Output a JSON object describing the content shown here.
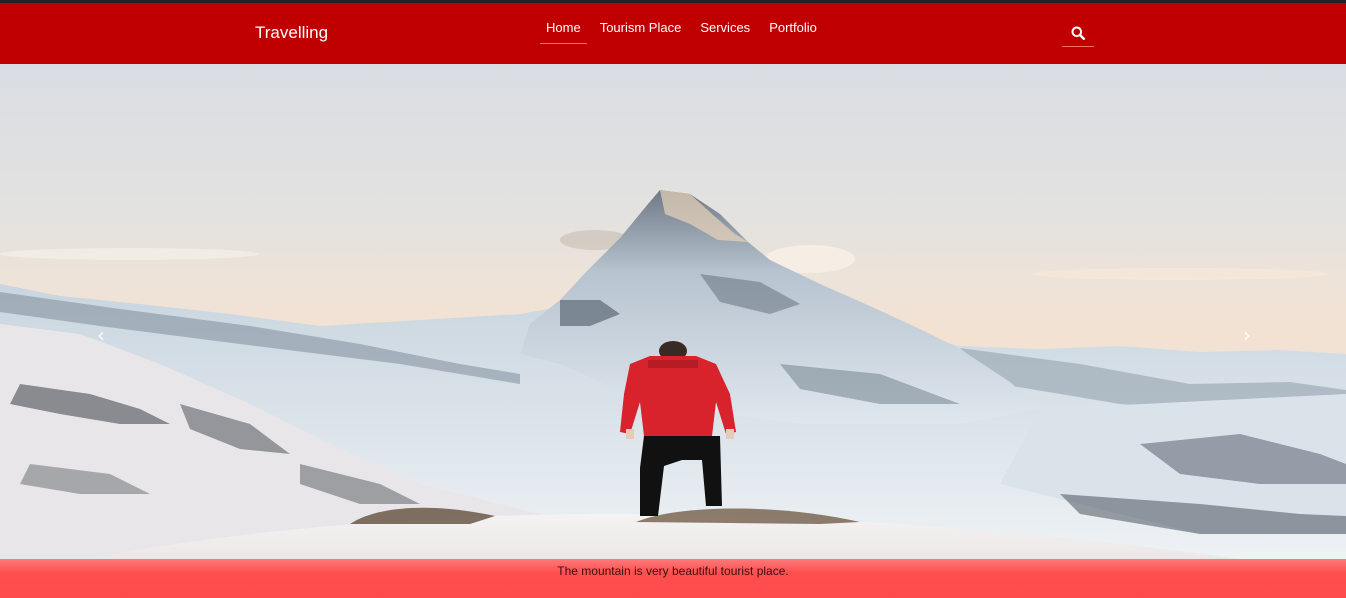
{
  "brand": {
    "title": "Travelling"
  },
  "nav": {
    "items": [
      {
        "label": "Home",
        "active": true
      },
      {
        "label": "Tourism Place",
        "active": false
      },
      {
        "label": "Services",
        "active": false
      },
      {
        "label": "Portfolio",
        "active": false
      }
    ]
  },
  "search": {
    "icon": "search-icon"
  },
  "carousel": {
    "prev_icon": "chevron-left-icon",
    "next_icon": "chevron-right-icon",
    "caption": "The mountain is very beautiful tourist place."
  },
  "colors": {
    "navbar": "#c00000",
    "caption_bar": "#ff4f4f",
    "active_underline": "#ff6a6a"
  }
}
